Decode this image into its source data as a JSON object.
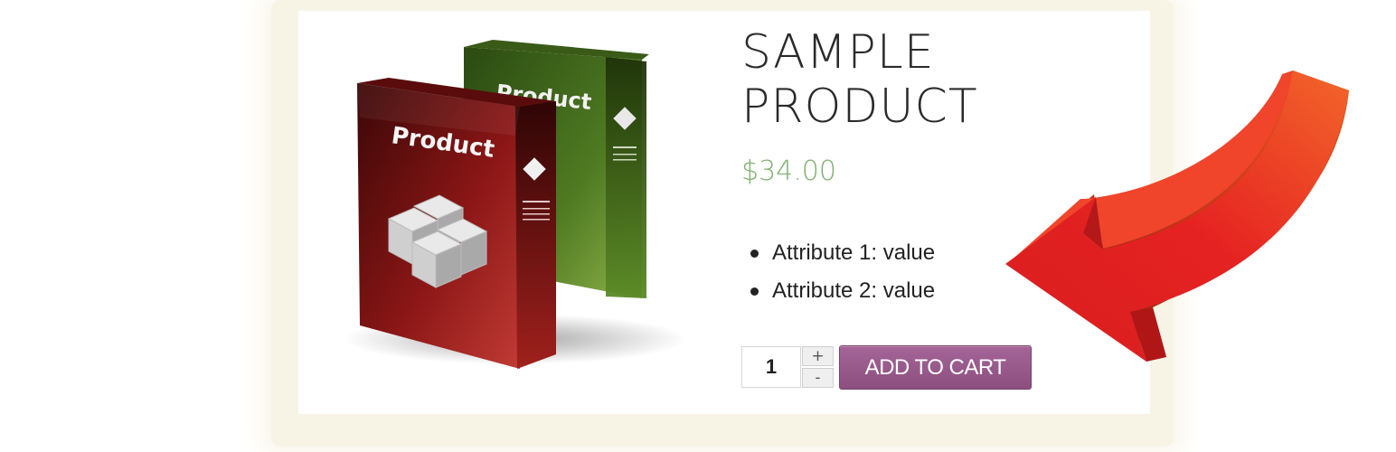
{
  "product": {
    "title_line1": "SAMPLE",
    "title_line2": "PRODUCT",
    "price": "$34.00",
    "attributes": [
      "Attribute 1: value",
      "Attribute 2: value"
    ],
    "box_label_front": "Product",
    "box_label_back": "Product"
  },
  "cart": {
    "quantity": "1",
    "increment": "+",
    "decrement": "-",
    "add_label": "ADD TO CART"
  },
  "colors": {
    "price": "#7fb06f",
    "button": "#9b5c8f",
    "arrow": "#e52222",
    "page_glow": "#f7f4e6"
  },
  "icons": {
    "arrow": "curved-pointer-arrow",
    "image": "product-box-image"
  }
}
